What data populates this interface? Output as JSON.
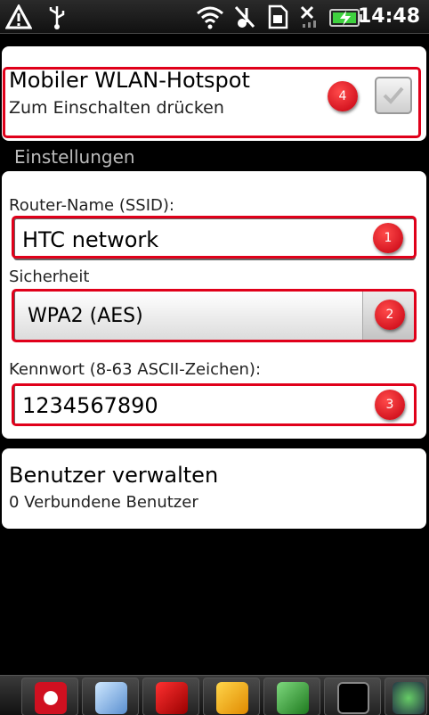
{
  "status_bar": {
    "time": "14:48",
    "icons": [
      "warning-icon",
      "usb-icon",
      "wifi-icon",
      "no-sound-icon",
      "sim-icon",
      "no-signal-icon",
      "battery-charging-icon"
    ]
  },
  "hotspot": {
    "title": "Mobiler WLAN-Hotspot",
    "subtitle": "Zum Einschalten drücken",
    "checked": true,
    "badge": "4"
  },
  "settings": {
    "header": "Einstellungen",
    "ssid_label": "Router-Name (SSID):",
    "ssid_value": "HTC network",
    "ssid_badge": "1",
    "security_label": "Sicherheit",
    "security_value": "WPA2 (AES)",
    "security_badge": "2",
    "password_label": "Kennwort (8-63 ASCII-Zeichen):",
    "password_value": "1234567890",
    "password_badge": "3"
  },
  "users": {
    "title": "Benutzer verwalten",
    "subtitle": "0 Verbundene Benutzer"
  },
  "dock": {
    "apps": [
      "media-player-icon",
      "notes-icon",
      "sprint-icon",
      "outlook-icon",
      "excel-icon",
      "terminal-icon",
      "chart-app-icon"
    ]
  },
  "colors": {
    "highlight": "#e0001a",
    "background": "#000000",
    "card": "#ffffff",
    "battery": "#3fd13f"
  }
}
